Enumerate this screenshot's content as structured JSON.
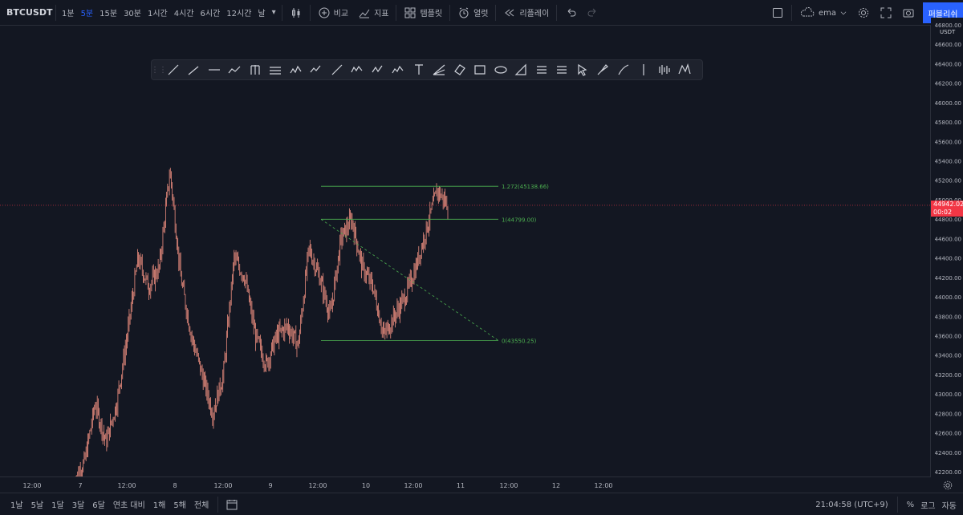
{
  "toolbar": {
    "symbol": "BTCUSDT",
    "intervals": [
      "1분",
      "5분",
      "15분",
      "30분",
      "1시간",
      "4시간",
      "6시간",
      "12시간",
      "날"
    ],
    "active_interval": "5분",
    "compare_label": "비교",
    "indicators_label": "지표",
    "templates_label": "템플릿",
    "alert_label": "얼럿",
    "replay_label": "리플레이",
    "layout_name": "ema",
    "publish_label": "퍼블리쉬"
  },
  "drawing_tools": [
    "trend-line-icon",
    "ray-icon",
    "horizontal-ray-icon",
    "polyline-icon",
    "pitchfork-icon",
    "parallel-channel-icon",
    "wave-wz-icon",
    "wave-12-icon",
    "line-icon",
    "wave-wx-icon",
    "wave-ac-icon",
    "wave-ae-icon",
    "text-icon",
    "fib-fan-icon",
    "rotated-rect-icon",
    "rectangle-icon",
    "ellipse-icon",
    "triangle-icon",
    "long-position-icon",
    "short-position-icon",
    "cursor-icon",
    "brush-icon",
    "highlighter-icon",
    "vertical-line-icon",
    "bars-pattern-icon",
    "xabcd-pattern-icon"
  ],
  "price_axis": {
    "unit": "USDT",
    "ticks": [
      "46800.00",
      "46600.00",
      "46400.00",
      "46200.00",
      "46000.00",
      "45800.00",
      "45600.00",
      "45400.00",
      "45200.00",
      "45000.00",
      "44800.00",
      "44600.00",
      "44400.00",
      "44200.00",
      "44000.00",
      "43800.00",
      "43600.00",
      "43400.00",
      "43200.00",
      "43000.00",
      "42800.00",
      "42600.00",
      "42400.00",
      "42200.00"
    ],
    "last_price": "44942.02",
    "countdown": "00:02"
  },
  "time_axis": {
    "labels": [
      "12:00",
      "7",
      "12:00",
      "8",
      "12:00",
      "9",
      "12:00",
      "10",
      "12:00",
      "11",
      "12:00",
      "12",
      "12:00"
    ]
  },
  "fib_levels": [
    {
      "label": "1.272(45138.66)",
      "price": 45138.66
    },
    {
      "label": "1(44799.00)",
      "price": 44799.0
    },
    {
      "label": "0(43550.25)",
      "price": 43550.25
    }
  ],
  "bottom_bar": {
    "ranges": [
      "1날",
      "5날",
      "1달",
      "3달",
      "6달",
      "연초 대비",
      "1해",
      "5해",
      "전체"
    ],
    "clock": "21:04:58 (UTC+9)",
    "percent_label": "%",
    "log_label": "로그",
    "auto_label": "자동"
  },
  "colors": {
    "background": "#131722",
    "candle": "#ef8f80",
    "fib_line": "#4caf50",
    "accent": "#2962ff",
    "last_price": "#f23645"
  },
  "chart_data": {
    "type": "candlestick",
    "symbol": "BTCUSDT",
    "ylim": [
      42100,
      46900
    ],
    "x": [
      "12:00",
      "7",
      "12:00",
      "8",
      "12:00",
      "9",
      "12:00",
      "10",
      "12:00",
      "11"
    ],
    "values": [
      42100,
      42300,
      42900,
      42500,
      42900,
      43600,
      44400,
      44100,
      44300,
      45300,
      44200,
      43600,
      43200,
      42800,
      43200,
      44400,
      44200,
      43600,
      43300,
      43600,
      43700,
      43500,
      44500,
      44200,
      43800,
      44600,
      44800,
      44300,
      44100,
      43600,
      43800,
      44000,
      44300,
      44700,
      45100,
      44942
    ]
  }
}
